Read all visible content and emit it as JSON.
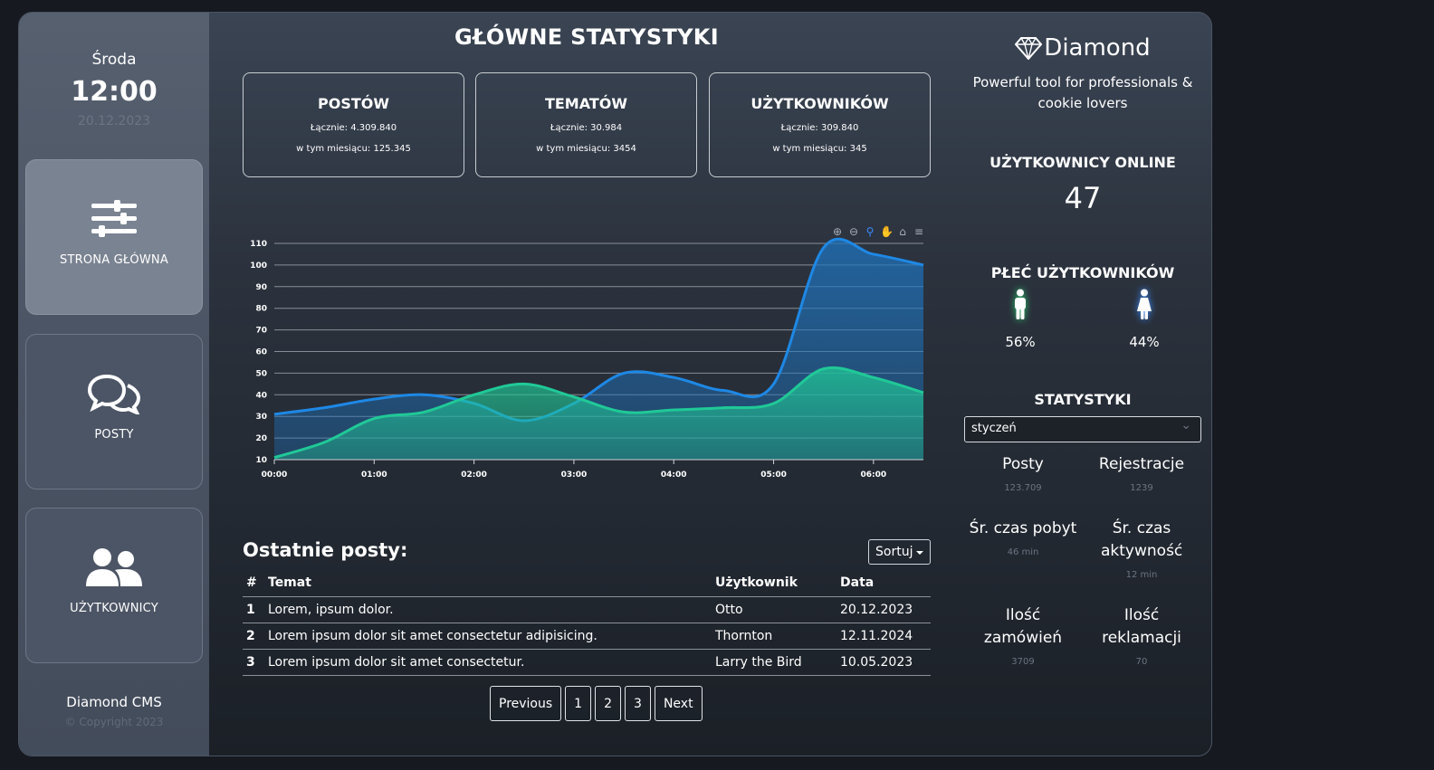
{
  "sidebar": {
    "day": "Środa",
    "time": "12:00",
    "date": "20.12.2023",
    "items": [
      {
        "label": "STRONA GŁÓWNA",
        "icon": "sliders-icon"
      },
      {
        "label": "POSTY",
        "icon": "chat-bubbles-icon"
      },
      {
        "label": "UŻYTKOWNICY",
        "icon": "users-icon"
      }
    ],
    "footer_brand": "Diamond CMS",
    "footer_copy": "© Copyright 2023"
  },
  "main": {
    "title": "GŁÓWNE STATYSTYKI",
    "cards": [
      {
        "title": "POSTÓW",
        "total": "Łącznie: 4.309.840",
        "month": "w tym miesiącu: 125.345"
      },
      {
        "title": "TEMATÓW",
        "total": "Łącznie: 30.984",
        "month": "w tym miesiącu: 3454"
      },
      {
        "title": "UŻYTKOWNIKÓW",
        "total": "Łącznie: 309.840",
        "month": "w tym miesiącu: 345"
      }
    ]
  },
  "chart_data": {
    "type": "area",
    "x": [
      "00:00",
      "00:30",
      "01:00",
      "01:30",
      "02:00",
      "02:30",
      "03:00",
      "03:30",
      "04:00",
      "04:30",
      "05:00",
      "05:30",
      "06:00",
      "06:30"
    ],
    "x_ticks": [
      "00:00",
      "01:00",
      "02:00",
      "03:00",
      "04:00",
      "05:00",
      "06:00"
    ],
    "ylim": [
      10,
      110
    ],
    "y_ticks": [
      10,
      20,
      30,
      40,
      50,
      60,
      70,
      80,
      90,
      100,
      110
    ],
    "grid": true,
    "series": [
      {
        "color": "#1e88e5",
        "values": [
          31,
          34,
          38,
          40,
          36,
          28,
          36,
          50,
          48,
          42,
          45,
          108,
          105,
          100
        ]
      },
      {
        "color": "#20c997",
        "values": [
          11,
          18,
          29,
          32,
          40,
          45,
          39,
          32,
          33,
          34,
          36,
          52,
          48,
          41
        ]
      }
    ]
  },
  "chart_toolbar": [
    "zoom-in-icon",
    "zoom-out-icon",
    "magnifier-icon",
    "pan-hand-icon",
    "home-icon",
    "menu-icon"
  ],
  "posts": {
    "title": "Ostatnie posty:",
    "sort_label": "Sortuj",
    "columns": [
      "#",
      "Temat",
      "Użytkownik",
      "Data"
    ],
    "rows": [
      [
        "1",
        "Lorem, ipsum dolor.",
        "Otto",
        "20.12.2023"
      ],
      [
        "2",
        "Lorem ipsum dolor sit amet consectetur adipisicing.",
        "Thornton",
        "12.11.2024"
      ],
      [
        "3",
        "Lorem ipsum dolor sit amet consectetur.",
        "Larry the Bird",
        "10.05.2023"
      ]
    ],
    "pager": [
      "Previous",
      "1",
      "2",
      "3",
      "Next"
    ]
  },
  "right": {
    "brand": "Diamond",
    "tagline": "Powerful tool for professionals & cookie lovers",
    "online_title": "UŻYTKOWNICY ONLINE",
    "online_count": "47",
    "gender_title": "PŁEĆ UŻYTKOWNIKÓW",
    "male_pct": "56%",
    "female_pct": "44%",
    "stats_title": "STATYSTYKI",
    "month_selected": "styczeń",
    "stats": [
      {
        "label": "Posty",
        "value": "123.709"
      },
      {
        "label": "Rejestracje",
        "value": "1239"
      },
      {
        "label": "Śr. czas pobyt",
        "value": "46 min"
      },
      {
        "label": "Śr. czas aktywność",
        "value": "12 min"
      },
      {
        "label": "Ilość zamówień",
        "value": "3709"
      },
      {
        "label": "Ilość reklamacji",
        "value": "70"
      }
    ],
    "colors": {
      "male": "#2ecc71",
      "female": "#3b8bff"
    }
  }
}
